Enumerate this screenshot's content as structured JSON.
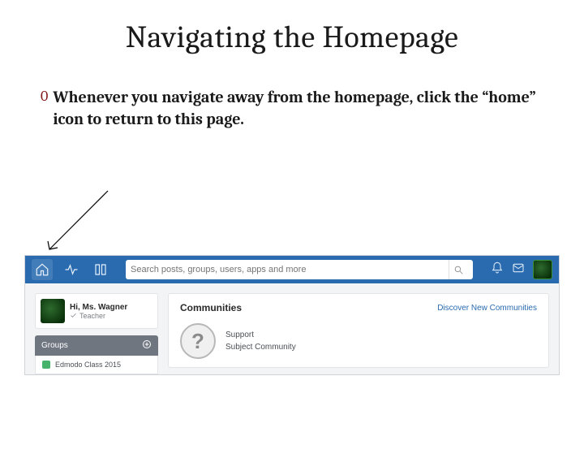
{
  "slide": {
    "title": "Navigating the Homepage",
    "bullet_number": "0",
    "bullet_text": "Whenever you navigate away from the homepage, click the “home” icon to return to this page."
  },
  "app": {
    "search_placeholder": "Search posts, groups, users, apps and more",
    "user": {
      "greeting": "Hi, Ms. Wagner",
      "role": "Teacher"
    },
    "groups": {
      "header": "Groups",
      "items": [
        "Edmodo Class 2015"
      ]
    },
    "communities": {
      "title": "Communities",
      "discover": "Discover New Communities",
      "line1": "Support",
      "line2": "Subject Community"
    }
  }
}
